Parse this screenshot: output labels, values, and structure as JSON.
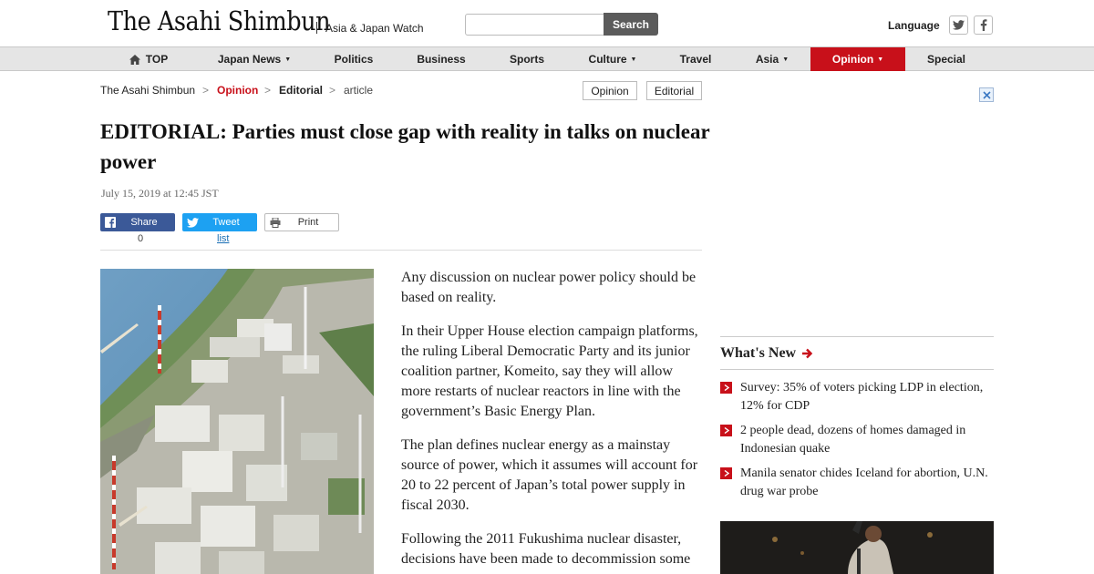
{
  "header": {
    "logo": "The Asahi Shimbun",
    "tagline": "Asia & Japan Watch",
    "search_placeholder": "",
    "search_button": "Search",
    "language": "Language"
  },
  "nav": {
    "items": [
      {
        "label": "TOP"
      },
      {
        "label": "Japan News"
      },
      {
        "label": "Politics"
      },
      {
        "label": "Business"
      },
      {
        "label": "Sports"
      },
      {
        "label": "Culture"
      },
      {
        "label": "Travel"
      },
      {
        "label": "Asia"
      },
      {
        "label": "Opinion"
      },
      {
        "label": "Special"
      }
    ]
  },
  "breadcrumb": {
    "home": "The Asahi Shimbun",
    "section": "Opinion",
    "subsection": "Editorial",
    "current": "article",
    "sep": ">"
  },
  "tags": [
    "Opinion",
    "Editorial"
  ],
  "article": {
    "title": "EDITORIAL: Parties must close gap with reality in talks on nuclear power",
    "date": "July 15, 2019 at 12:45 JST",
    "share": {
      "facebook_label": "Share",
      "facebook_count": "0",
      "tweet_label": "Tweet",
      "tweet_count": "list",
      "print_label": "Print"
    },
    "paragraphs": [
      "Any discussion on nuclear power policy should be based on reality.",
      "In their Upper House election campaign platforms, the ruling Liberal Democratic Party and its junior coalition partner, Komeito, say they will allow more restarts of nuclear reactors in line with the government’s Basic Energy Plan.",
      "The plan defines nuclear energy as a mainstay source of power, which it assumes will account for 20 to 22 percent of Japan’s total power supply in fiscal 2030.",
      "Following the 2011 Fukushima nuclear disaster, decisions have been made to decommission some"
    ]
  },
  "sidebar": {
    "whats_new_title": "What's New",
    "news": [
      "Survey: 35% of voters picking LDP in election, 12% for CDP",
      "2 people dead, dozens of homes damaged in Indonesian quake",
      "Manila senator chides Iceland for abortion, U.N. drug war probe"
    ]
  },
  "colors": {
    "brand_red": "#c8101a",
    "facebook": "#3b5998",
    "twitter": "#1da1f2"
  }
}
